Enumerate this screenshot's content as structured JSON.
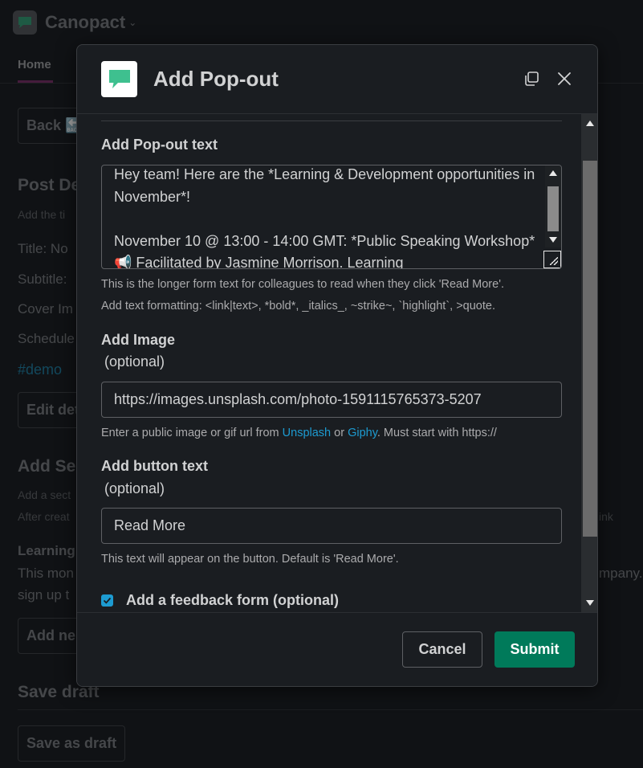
{
  "background": {
    "brand": "Canopact",
    "tab_home": "Home",
    "back_button": "Back 🔙",
    "section_post_details": "Post De",
    "post_details_hint": "Add the ti",
    "title_row": "Title: No",
    "subtitle_row": "Subtitle:",
    "cover_row": "Cover Im",
    "schedule_row": "Schedule",
    "tag": "#demo",
    "edit_button": "Edit det",
    "section_add": "Add Se",
    "add_hint": "Add a sect",
    "after_hint": "After creat",
    "link_fragment": "ink",
    "learning_title": "Learning",
    "learning_body_1": "This mon",
    "learning_body_1_end": "mpany. T",
    "learning_body_2": "sign up t",
    "add_new_button": "Add ne",
    "section_save": "Save draft",
    "save_button": "Save as draft"
  },
  "modal": {
    "title": "Add Pop-out",
    "popout_text": {
      "label": "Add Pop-out text",
      "value": "Hey team! Here are the *Learning & Development opportunities in November*!\n\nNovember 10 @ 13:00 - 14:00 GMT: *Public Speaking Workshop* 📢 Facilitated by Jasmine Morrison. Learning",
      "help_1": "This is the longer form text for colleagues to read when they click 'Read More'.",
      "help_2": "Add text formatting: <link|text>, *bold*, _italics_, ~strike~, `highlight`, >quote."
    },
    "image": {
      "label": "Add Image",
      "optional": "(optional)",
      "value": "https://images.unsplash.com/photo-1591115765373-5207",
      "help_prefix": "Enter a public image or gif url from ",
      "link_unsplash": "Unsplash",
      "help_or": " or ",
      "link_giphy": "Giphy",
      "help_suffix": ". Must start with https://"
    },
    "button_text": {
      "label": "Add button text",
      "optional": "(optional)",
      "placeholder": "Read More",
      "help": "This text will appear on the button. Default is 'Read More'."
    },
    "feedback": {
      "label": "Add a feedback form (optional)",
      "checked": true
    },
    "cancel_label": "Cancel",
    "submit_label": "Submit"
  },
  "colors": {
    "brand_green": "#3ec08f",
    "submit_bg": "#007a5a",
    "link_blue": "#1d9bd1",
    "checkbox_blue": "#1d9bd1"
  },
  "icons": {
    "logo": "chat-bubble-icon",
    "expand": "copy-window-icon",
    "close": "close-icon",
    "check": "checkmark-icon"
  }
}
